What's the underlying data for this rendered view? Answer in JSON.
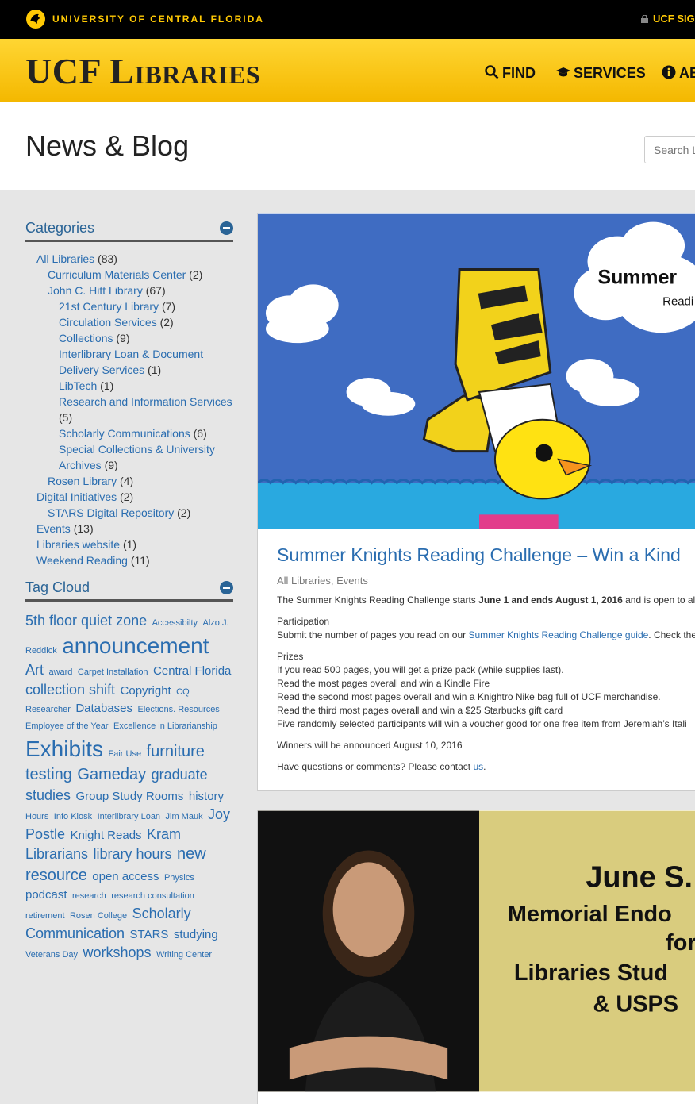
{
  "topbar": {
    "university": "UNIVERSITY OF CENTRAL FLORIDA",
    "signon": "UCF SIG"
  },
  "header": {
    "brand": "UCF Libraries",
    "nav": [
      {
        "label": "FIND",
        "icon": "search-icon"
      },
      {
        "label": "SERVICES",
        "icon": "graduation-cap-icon"
      },
      {
        "label": "AB",
        "icon": "info-circle-icon"
      }
    ]
  },
  "page": {
    "title": "News & Blog",
    "search_placeholder": "Search L"
  },
  "sidebar": {
    "categories_title": "Categories",
    "categories": [
      {
        "label": "All Libraries",
        "count": "(83)",
        "level": 0
      },
      {
        "label": "Curriculum Materials Center",
        "count": "(2)",
        "level": 1
      },
      {
        "label": "John C. Hitt Library",
        "count": "(67)",
        "level": 1
      },
      {
        "label": "21st Century Library",
        "count": "(7)",
        "level": 2
      },
      {
        "label": "Circulation Services",
        "count": "(2)",
        "level": 2
      },
      {
        "label": "Collections",
        "count": "(9)",
        "level": 2
      },
      {
        "label": "Interlibrary Loan & Document Delivery Services",
        "count": "(1)",
        "level": 2
      },
      {
        "label": "LibTech",
        "count": "(1)",
        "level": 2
      },
      {
        "label": "Research and Information Services",
        "count": "(5)",
        "level": 2
      },
      {
        "label": "Scholarly Communications",
        "count": "(6)",
        "level": 2
      },
      {
        "label": "Special Collections & University Archives",
        "count": "(9)",
        "level": 2
      },
      {
        "label": "Rosen Library",
        "count": "(4)",
        "level": 1
      },
      {
        "label": "Digital Initiatives",
        "count": "(2)",
        "level": 0
      },
      {
        "label": "STARS Digital Repository",
        "count": "(2)",
        "level": 1
      },
      {
        "label": "Events",
        "count": "(13)",
        "level": 0
      },
      {
        "label": "Libraries website",
        "count": "(1)",
        "level": 0
      },
      {
        "label": "Weekend Reading",
        "count": "(11)",
        "level": 0
      }
    ],
    "tagcloud_title": "Tag Cloud",
    "tags": [
      {
        "label": "5th floor quiet zone",
        "size": 4
      },
      {
        "label": "Accessibilty",
        "size": 1
      },
      {
        "label": "Alzo J. Reddick",
        "size": 1
      },
      {
        "label": "announcement",
        "size": 6
      },
      {
        "label": "Art",
        "size": 4
      },
      {
        "label": "award",
        "size": 1
      },
      {
        "label": "Carpet Installation",
        "size": 1
      },
      {
        "label": "Central Florida",
        "size": 3
      },
      {
        "label": "collection shift",
        "size": 4
      },
      {
        "label": "Copyright",
        "size": 3
      },
      {
        "label": "CQ Researcher",
        "size": 1
      },
      {
        "label": "Databases",
        "size": 3
      },
      {
        "label": "Elections. Resources",
        "size": 1
      },
      {
        "label": "Employee of the Year",
        "size": 1
      },
      {
        "label": "Excellence in Librarianship",
        "size": 1
      },
      {
        "label": "Exhibits",
        "size": 6
      },
      {
        "label": "Fair Use",
        "size": 1
      },
      {
        "label": "furniture testing",
        "size": 5
      },
      {
        "label": "Gameday",
        "size": 5
      },
      {
        "label": "graduate studies",
        "size": 4
      },
      {
        "label": "Group Study Rooms",
        "size": 3
      },
      {
        "label": "history",
        "size": 3
      },
      {
        "label": "Hours",
        "size": 1
      },
      {
        "label": "Info Kiosk",
        "size": 1
      },
      {
        "label": "Interlibrary Loan",
        "size": 1
      },
      {
        "label": "Jim Mauk",
        "size": 1
      },
      {
        "label": "Joy Postle",
        "size": 4
      },
      {
        "label": "Knight Reads",
        "size": 3
      },
      {
        "label": "Kram Librarians",
        "size": 4
      },
      {
        "label": "library hours",
        "size": 4
      },
      {
        "label": "new resource",
        "size": 5
      },
      {
        "label": "open access",
        "size": 3
      },
      {
        "label": "Physics",
        "size": 1
      },
      {
        "label": "podcast",
        "size": 3
      },
      {
        "label": "research",
        "size": 1
      },
      {
        "label": "research consultation",
        "size": 1
      },
      {
        "label": "retirement",
        "size": 1
      },
      {
        "label": "Rosen College",
        "size": 1
      },
      {
        "label": "Scholarly Communication",
        "size": 4
      },
      {
        "label": "STARS",
        "size": 3
      },
      {
        "label": "studying",
        "size": 3
      },
      {
        "label": "Veterans Day",
        "size": 1
      },
      {
        "label": "workshops",
        "size": 4
      },
      {
        "label": "Writing Center",
        "size": 1
      }
    ]
  },
  "post1": {
    "image_text_1": "Summer",
    "image_text_2": "Readi",
    "title": "Summer Knights Reading Challenge – Win a Kind",
    "categories": "All Libraries, Events",
    "intro_a": "The Summer Knights Reading Challenge starts ",
    "intro_b": "June 1 and ends August 1, 2016",
    "intro_c": " and is open to all",
    "participation_heading": "Participation",
    "participation_a": "Submit the number of pages you read on our ",
    "participation_link": "Summer Knights Reading Challenge guide",
    "participation_b": ". Check the",
    "prizes_heading": "Prizes",
    "prizes": [
      "If you read 500 pages, you will get a prize pack (while supplies last).",
      "Read the most pages overall and win a Kindle Fire",
      "Read the second most pages overall and win a Knightro Nike bag full of UCF merchandise.",
      "Read the third most pages overall and win a $25 Starbucks gift card",
      "Five randomly selected participants will win a voucher good for one free item from Jeremiah’s Itali"
    ],
    "winners": "Winners will be announced August 10, 2016",
    "contact_a": "Have questions or comments?  Please contact ",
    "contact_link": "us",
    "contact_b": "."
  },
  "post2": {
    "image_lines": [
      "June S.",
      "Memorial Endo",
      "for",
      "Libraries Stud",
      "& USPS"
    ]
  },
  "colors": {
    "gold": "#ffc904",
    "link": "#2a6db0",
    "black": "#000000"
  }
}
